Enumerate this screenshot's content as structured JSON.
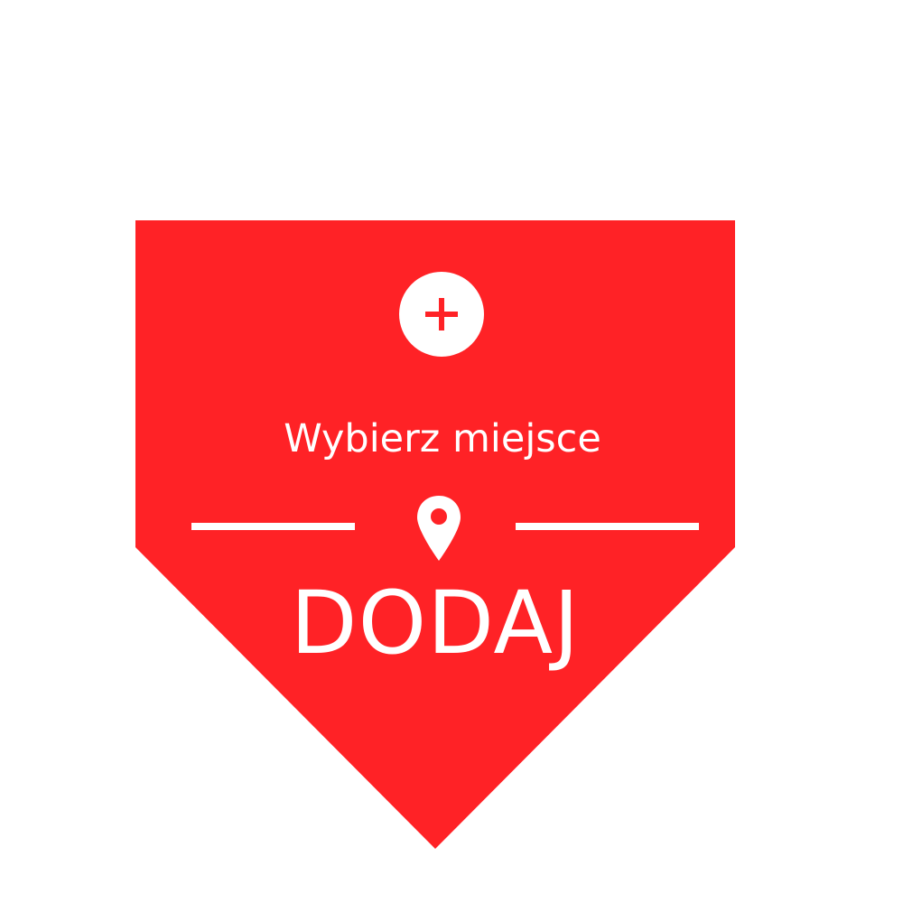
{
  "badge": {
    "subtitle": "Wybierz miejsce",
    "cta_label": "DODAJ",
    "plus_icon": "plus-icon",
    "pin_icon": "map-pin-icon"
  },
  "colors": {
    "background": "#ffffff",
    "accent": "#ff2226",
    "foreground": "#ffffff"
  }
}
